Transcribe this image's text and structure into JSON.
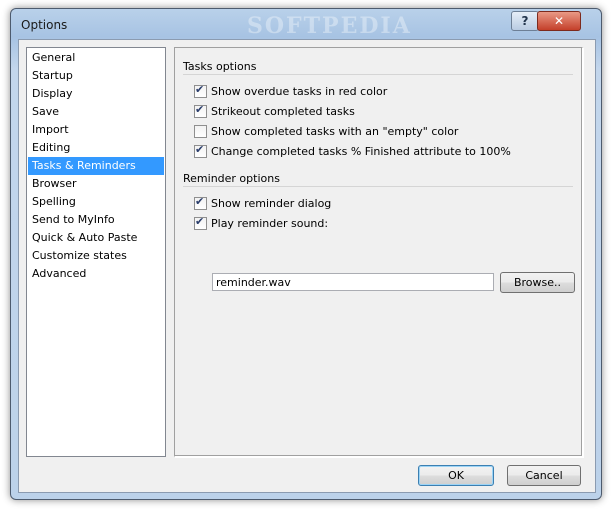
{
  "window": {
    "title": "Options",
    "watermark": "SOFTPEDIA",
    "help_glyph": "?",
    "close_glyph": "✕"
  },
  "nav": {
    "items": [
      "General",
      "Startup",
      "Display",
      "Save",
      "Import",
      "Editing",
      "Tasks & Reminders",
      "Browser",
      "Spelling",
      "Send to MyInfo",
      "Quick & Auto Paste",
      "Customize states",
      "Advanced"
    ],
    "selected": "Tasks & Reminders"
  },
  "tasks": {
    "header": "Tasks options",
    "options": [
      {
        "label": "Show overdue tasks in red color",
        "checked": true
      },
      {
        "label": "Strikeout completed tasks",
        "checked": true
      },
      {
        "label": "Show completed tasks with an \"empty\" color",
        "checked": false
      },
      {
        "label": "Change completed tasks % Finished attribute to 100%",
        "checked": true
      }
    ]
  },
  "reminder": {
    "header": "Reminder options",
    "options": [
      {
        "label": "Show reminder dialog",
        "checked": true
      },
      {
        "label": "Play reminder sound:",
        "checked": true
      }
    ],
    "sound_file": "reminder.wav",
    "browse_label": "Browse.."
  },
  "buttons": {
    "ok": "OK",
    "cancel": "Cancel"
  }
}
